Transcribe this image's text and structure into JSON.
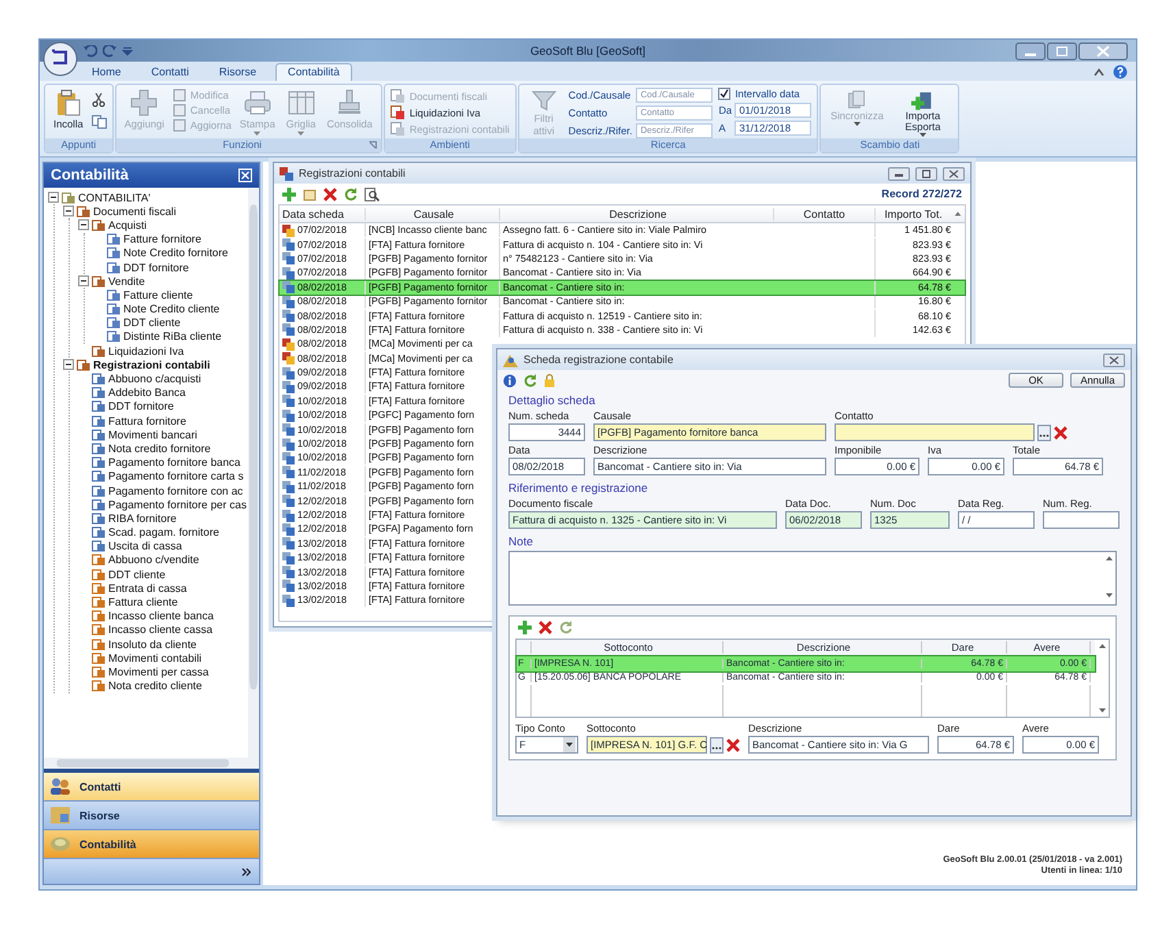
{
  "window": {
    "title": "GeoSoft Blu [GeoSoft]"
  },
  "ribbon": {
    "tabs": [
      {
        "label": "Home",
        "selected": false
      },
      {
        "label": "Contatti",
        "selected": false
      },
      {
        "label": "Risorse",
        "selected": false
      },
      {
        "label": "Contabilità",
        "selected": true
      }
    ],
    "clipboard": {
      "title": "Appunti",
      "paste": "Incolla"
    },
    "functions": {
      "title": "Funzioni",
      "items": [
        {
          "kind": "large",
          "label": "Aggiungi",
          "disabled": true,
          "menu": false
        },
        {
          "kind": "stack",
          "items": [
            {
              "label": "Modifica",
              "disabled": true
            },
            {
              "label": "Cancella",
              "disabled": true
            },
            {
              "label": "Aggiorna",
              "disabled": true
            }
          ]
        },
        {
          "kind": "large",
          "label": "Stampa",
          "disabled": true,
          "menu": true
        },
        {
          "kind": "large",
          "label": "Griglia",
          "disabled": true,
          "menu": true
        },
        {
          "kind": "large",
          "label": "Consolida",
          "disabled": true,
          "menu": false
        }
      ]
    },
    "environments": {
      "title": "Ambienti",
      "items": [
        {
          "label": "Documenti fiscali",
          "disabled": true
        },
        {
          "label": "Liquidazioni Iva",
          "disabled": false
        },
        {
          "label": "Registrazioni contabili",
          "disabled": true
        }
      ]
    },
    "search": {
      "title": "Ricerca",
      "filters": {
        "label": "Filtri attivi",
        "disabled": true
      },
      "fields": [
        {
          "label": "Cod./Causale",
          "placeholder": "Cod./Causale"
        },
        {
          "label": "Contatto",
          "placeholder": "Contatto"
        },
        {
          "label": "Descriz./Rifer.",
          "placeholder": "Descriz./Rifer"
        }
      ],
      "date_range": {
        "label": "Intervallo data",
        "checked": true,
        "from_label": "Da",
        "from": "01/01/2018",
        "to_label": "A",
        "to": "31/12/2018"
      }
    },
    "exchange": {
      "title": "Scambio dati",
      "items": [
        {
          "label": "Sincronizza",
          "disabled": true,
          "menu": true
        },
        {
          "label": "Importa Esporta",
          "disabled": false,
          "menu": true
        }
      ]
    }
  },
  "sidebar": {
    "title": "Contabilità",
    "tree": [
      {
        "label": "CONTABILITA'",
        "kind": "root",
        "selected": false,
        "expanded": true,
        "children": [
          {
            "label": "Documenti fiscali",
            "kind": "folder",
            "selected": false,
            "expanded": true,
            "children": [
              {
                "label": "Acquisti",
                "kind": "folder",
                "selected": false,
                "expanded": true,
                "children": [
                  {
                    "label": "Fatture fornitore",
                    "kind": "doc",
                    "selected": false
                  },
                  {
                    "label": "Note Credito fornitore",
                    "kind": "doc",
                    "selected": false
                  },
                  {
                    "label": "DDT fornitore",
                    "kind": "doc",
                    "selected": false
                  }
                ]
              },
              {
                "label": "Vendite",
                "kind": "folder",
                "selected": false,
                "expanded": true,
                "children": [
                  {
                    "label": "Fatture cliente",
                    "kind": "doc",
                    "selected": false
                  },
                  {
                    "label": "Note Credito cliente",
                    "kind": "doc",
                    "selected": false
                  },
                  {
                    "label": "DDT cliente",
                    "kind": "doc",
                    "selected": false
                  },
                  {
                    "label": "Distinte RiBa cliente",
                    "kind": "doc",
                    "selected": false
                  }
                ]
              },
              {
                "label": "Liquidazioni Iva",
                "kind": "folder",
                "selected": false
              }
            ]
          },
          {
            "label": "Registrazioni contabili",
            "kind": "folder",
            "selected": true,
            "expanded": true,
            "children": [
              {
                "label": "Abbuono c/acquisti",
                "kind": "supplier",
                "selected": false
              },
              {
                "label": "Addebito Banca",
                "kind": "supplier",
                "selected": false
              },
              {
                "label": "DDT fornitore",
                "kind": "supplier",
                "selected": false
              },
              {
                "label": "Fattura fornitore",
                "kind": "supplier",
                "selected": false
              },
              {
                "label": "Movimenti bancari",
                "kind": "supplier",
                "selected": false
              },
              {
                "label": "Nota credito fornitore",
                "kind": "supplier",
                "selected": false
              },
              {
                "label": "Pagamento fornitore banca",
                "kind": "supplier",
                "selected": false
              },
              {
                "label": "Pagamento fornitore carta s",
                "kind": "supplier",
                "selected": false
              },
              {
                "label": "Pagamento fornitore con ac",
                "kind": "supplier",
                "selected": false
              },
              {
                "label": "Pagamento fornitore per cas",
                "kind": "supplier",
                "selected": false
              },
              {
                "label": "RIBA fornitore",
                "kind": "supplier",
                "selected": false
              },
              {
                "label": "Scad. pagam. fornitore",
                "kind": "supplier",
                "selected": false
              },
              {
                "label": "Uscita di cassa",
                "kind": "supplier",
                "selected": false
              },
              {
                "label": "Abbuono c/vendite",
                "kind": "customer",
                "selected": false
              },
              {
                "label": "DDT cliente",
                "kind": "customer",
                "selected": false
              },
              {
                "label": "Entrata di cassa",
                "kind": "customer",
                "selected": false
              },
              {
                "label": "Fattura cliente",
                "kind": "customer",
                "selected": false
              },
              {
                "label": "Incasso cliente banca",
                "kind": "customer",
                "selected": false
              },
              {
                "label": "Incasso cliente cassa",
                "kind": "customer",
                "selected": false
              },
              {
                "label": "Insoluto da cliente",
                "kind": "customer",
                "selected": false
              },
              {
                "label": "Movimenti contabili",
                "kind": "customer",
                "selected": false
              },
              {
                "label": "Movimenti per cassa",
                "kind": "customer",
                "selected": false
              },
              {
                "label": "Nota credito cliente",
                "kind": "customer",
                "selected": false
              }
            ]
          }
        ]
      }
    ],
    "nav": [
      {
        "label": "Contatti",
        "selected": false,
        "hovered": true
      },
      {
        "label": "Risorse",
        "selected": false,
        "hovered": false
      },
      {
        "label": "Contabilità",
        "selected": true,
        "hovered": false
      }
    ]
  },
  "list_window": {
    "title": "Registrazioni contabili",
    "record": "Record 272/272",
    "columns": [
      "Data scheda",
      "Causale",
      "Descrizione",
      "Contatto",
      "Importo Tot."
    ],
    "rows": [
      {
        "kind": "customer",
        "date": "07/02/2018",
        "causale": "[NCB] Incasso cliente banc",
        "descrizione": "Assegno fatt. 6 - Cantiere sito in: Viale Palmiro",
        "importo": "1 451.80 €",
        "selected": false
      },
      {
        "kind": "supplier",
        "date": "07/02/2018",
        "causale": "[FTA] Fattura fornitore",
        "descrizione": "Fattura di acquisto n. 104 - Cantiere sito in: Vi",
        "importo": "823.93 €",
        "selected": false
      },
      {
        "kind": "supplier",
        "date": "07/02/2018",
        "causale": "[PGFB] Pagamento fornitor",
        "descrizione": "n° 75482123 - Cantiere sito in: Via",
        "importo": "823.93 €",
        "selected": false
      },
      {
        "kind": "supplier",
        "date": "07/02/2018",
        "causale": "[PGFB] Pagamento fornitor",
        "descrizione": "Bancomat - Cantiere sito in: Via",
        "importo": "664.90 €",
        "selected": false
      },
      {
        "kind": "supplier",
        "date": "08/02/2018",
        "causale": "[PGFB] Pagamento fornitor",
        "descrizione": "Bancomat - Cantiere sito in:",
        "importo": "64.78 €",
        "selected": true
      },
      {
        "kind": "supplier",
        "date": "08/02/2018",
        "causale": "[PGFB] Pagamento fornitor",
        "descrizione": "Bancomat  - Cantiere sito in:",
        "importo": "16.80 €",
        "selected": false
      },
      {
        "kind": "supplier",
        "date": "08/02/2018",
        "causale": "[FTA] Fattura fornitore",
        "descrizione": "Fattura di acquisto n. 12519 - Cantiere sito in:",
        "importo": "68.10 €",
        "selected": false
      },
      {
        "kind": "supplier",
        "date": "08/02/2018",
        "causale": "[FTA] Fattura fornitore",
        "descrizione": "Fattura di acquisto n. 338 - Cantiere sito in: Vi",
        "importo": "142.63 €",
        "selected": false
      },
      {
        "kind": "customer",
        "date": "08/02/2018",
        "causale": "[MCa] Movimenti per ca",
        "selected": false
      },
      {
        "kind": "customer",
        "date": "08/02/2018",
        "causale": "[MCa] Movimenti per ca",
        "selected": false
      },
      {
        "kind": "supplier",
        "date": "09/02/2018",
        "causale": "[FTA] Fattura fornitore",
        "selected": false
      },
      {
        "kind": "supplier",
        "date": "09/02/2018",
        "causale": "[FTA] Fattura fornitore",
        "selected": false
      },
      {
        "kind": "supplier",
        "date": "10/02/2018",
        "causale": "[FTA] Fattura fornitore",
        "selected": false
      },
      {
        "kind": "supplier",
        "date": "10/02/2018",
        "causale": "[PGFC] Pagamento forn",
        "selected": false
      },
      {
        "kind": "supplier",
        "date": "10/02/2018",
        "causale": "[PGFB] Pagamento forn",
        "selected": false
      },
      {
        "kind": "supplier",
        "date": "10/02/2018",
        "causale": "[PGFB] Pagamento forn",
        "selected": false
      },
      {
        "kind": "supplier",
        "date": "10/02/2018",
        "causale": "[PGFB] Pagamento forn",
        "selected": false
      },
      {
        "kind": "supplier",
        "date": "11/02/2018",
        "causale": "[PGFB] Pagamento forn",
        "selected": false
      },
      {
        "kind": "supplier",
        "date": "11/02/2018",
        "causale": "[PGFB] Pagamento forn",
        "selected": false
      },
      {
        "kind": "supplier",
        "date": "12/02/2018",
        "causale": "[PGFB] Pagamento forn",
        "selected": false
      },
      {
        "kind": "supplier",
        "date": "12/02/2018",
        "causale": "[FTA] Fattura fornitore",
        "selected": false
      },
      {
        "kind": "supplier",
        "date": "12/02/2018",
        "causale": "[PGFA] Pagamento forn",
        "selected": false
      },
      {
        "kind": "supplier",
        "date": "13/02/2018",
        "causale": "[FTA] Fattura fornitore",
        "selected": false
      },
      {
        "kind": "supplier",
        "date": "13/02/2018",
        "causale": "[FTA] Fattura fornitore",
        "selected": false
      },
      {
        "kind": "supplier",
        "date": "13/02/2018",
        "causale": "[FTA] Fattura fornitore",
        "selected": false
      },
      {
        "kind": "supplier",
        "date": "13/02/2018",
        "causale": "[FTA] Fattura fornitore",
        "selected": false
      },
      {
        "kind": "supplier",
        "date": "13/02/2018",
        "causale": "[FTA] Fattura fornitore",
        "selected": false
      }
    ]
  },
  "dialog": {
    "title": "Scheda registrazione contabile",
    "ok": "OK",
    "cancel": "Annulla",
    "detail": {
      "title": "Dettaglio scheda",
      "rows": [
        [
          {
            "label": "Num. scheda",
            "value": "3444",
            "kind": "number"
          },
          {
            "label": "Causale",
            "value": "[PGFB] Pagamento fornitore banca",
            "kind": "lookup"
          },
          {
            "label": "Contatto",
            "kind": "lookup-browse"
          }
        ],
        [
          {
            "label": "Data",
            "value": "08/02/2018",
            "kind": "text"
          },
          {
            "label": "Descrizione",
            "value": "Bancomat - Cantiere sito in: Via",
            "kind": "text"
          },
          {
            "label": "Imponibile",
            "value": "0.00 €",
            "kind": "number"
          },
          {
            "label": "Iva",
            "value": "0.00 €",
            "kind": "number"
          },
          {
            "label": "Totale",
            "value": "64.78 €",
            "kind": "number"
          }
        ]
      ]
    },
    "reference": {
      "title": "Riferimento e registrazione",
      "fields": [
        {
          "label": "Documento fiscale",
          "value": "Fattura di acquisto n. 1325 - Cantiere sito in: Vi",
          "kind": "reference"
        },
        {
          "label": "Data Doc.",
          "value": "06/02/2018",
          "kind": "reference"
        },
        {
          "label": "Num. Doc",
          "value": "1325",
          "kind": "reference"
        },
        {
          "label": "Data Reg.",
          "value": " / /",
          "kind": "text"
        },
        {
          "label": "Num. Reg.",
          "kind": "text"
        }
      ]
    },
    "note": {
      "title": "Note"
    },
    "lines": {
      "columns": [
        "Sottoconto",
        "Descrizione",
        "Dare",
        "Avere"
      ],
      "rows": [
        {
          "type": "F",
          "sottoconto": "[IMPRESA N. 101]",
          "descrizione": "Bancomat - Cantiere sito in:",
          "dare": "64.78 €",
          "avere": "0.00 €",
          "selected": true
        },
        {
          "type": "G",
          "sottoconto": "[15.20.05.06] BANCA POPOLARE",
          "descrizione": "Bancomat - Cantiere sito in:",
          "dare": "0.00 €",
          "avere": "64.78 €",
          "selected": false
        }
      ],
      "editor": {
        "type_label": "Tipo Conto",
        "type_value": "F",
        "fields": [
          {
            "label": "Sottoconto",
            "value": "[IMPRESA N. 101] G.F. C",
            "kind": "lookup-browse"
          },
          {
            "label": "Descrizione",
            "value": "Bancomat - Cantiere sito in: Via G",
            "kind": "text"
          },
          {
            "label": "Dare",
            "value": "64.78 €",
            "kind": "number"
          },
          {
            "label": "Avere",
            "value": "0.00 €",
            "kind": "number"
          }
        ]
      }
    }
  },
  "status": {
    "version": "GeoSoft Blu 2.00.01 (25/01/2018 - va 2.001)",
    "users": "Utenti in linea: 1/10"
  }
}
